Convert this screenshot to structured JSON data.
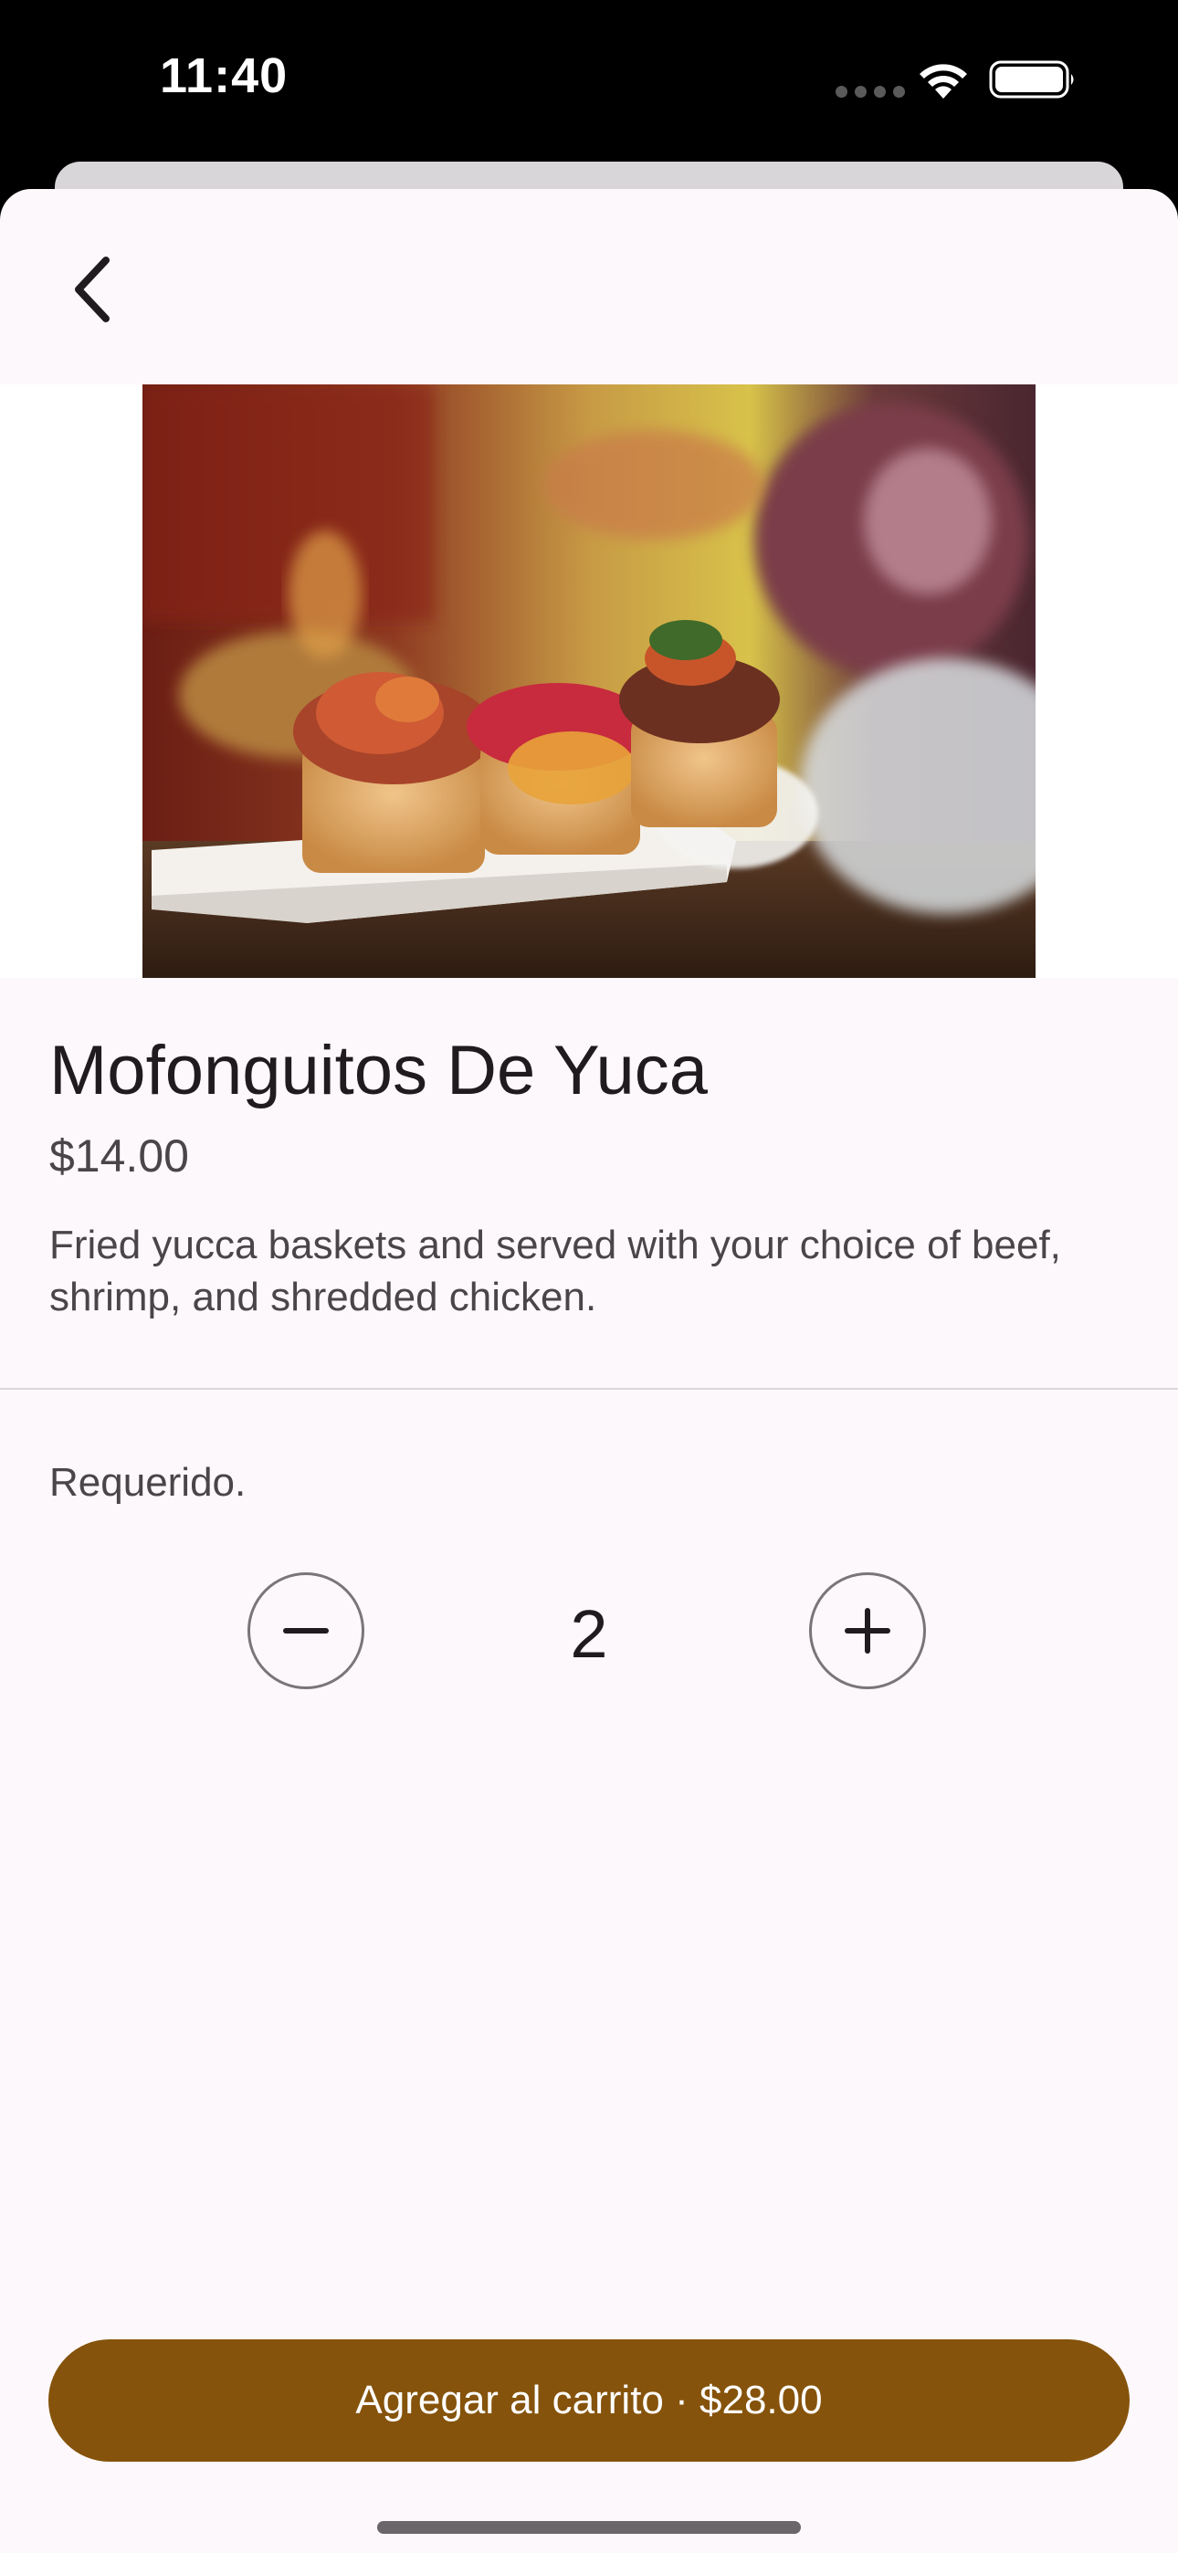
{
  "status_bar": {
    "time": "11:40",
    "icons": [
      "signal-dots-icon",
      "wifi-icon",
      "battery-icon"
    ]
  },
  "header": {
    "back_icon": "chevron-left-icon"
  },
  "product": {
    "image_icon": "fried-yucca-photo",
    "name": "Mofonguitos De Yuca",
    "price": "$14.00",
    "description": "Fried yucca baskets and served with your choice of beef, shrimp, and shredded chicken."
  },
  "options": {
    "required_label": "Requerido.",
    "quantity": "2",
    "decrement_icon": "minus-icon",
    "increment_icon": "plus-icon"
  },
  "cart_button": {
    "label": "Agregar al carrito · $28.00"
  },
  "colors": {
    "accent": "#85530b",
    "sheet_background": "#fdf8fb",
    "text_primary": "#1f1b1e",
    "text_secondary": "#4a4548"
  }
}
